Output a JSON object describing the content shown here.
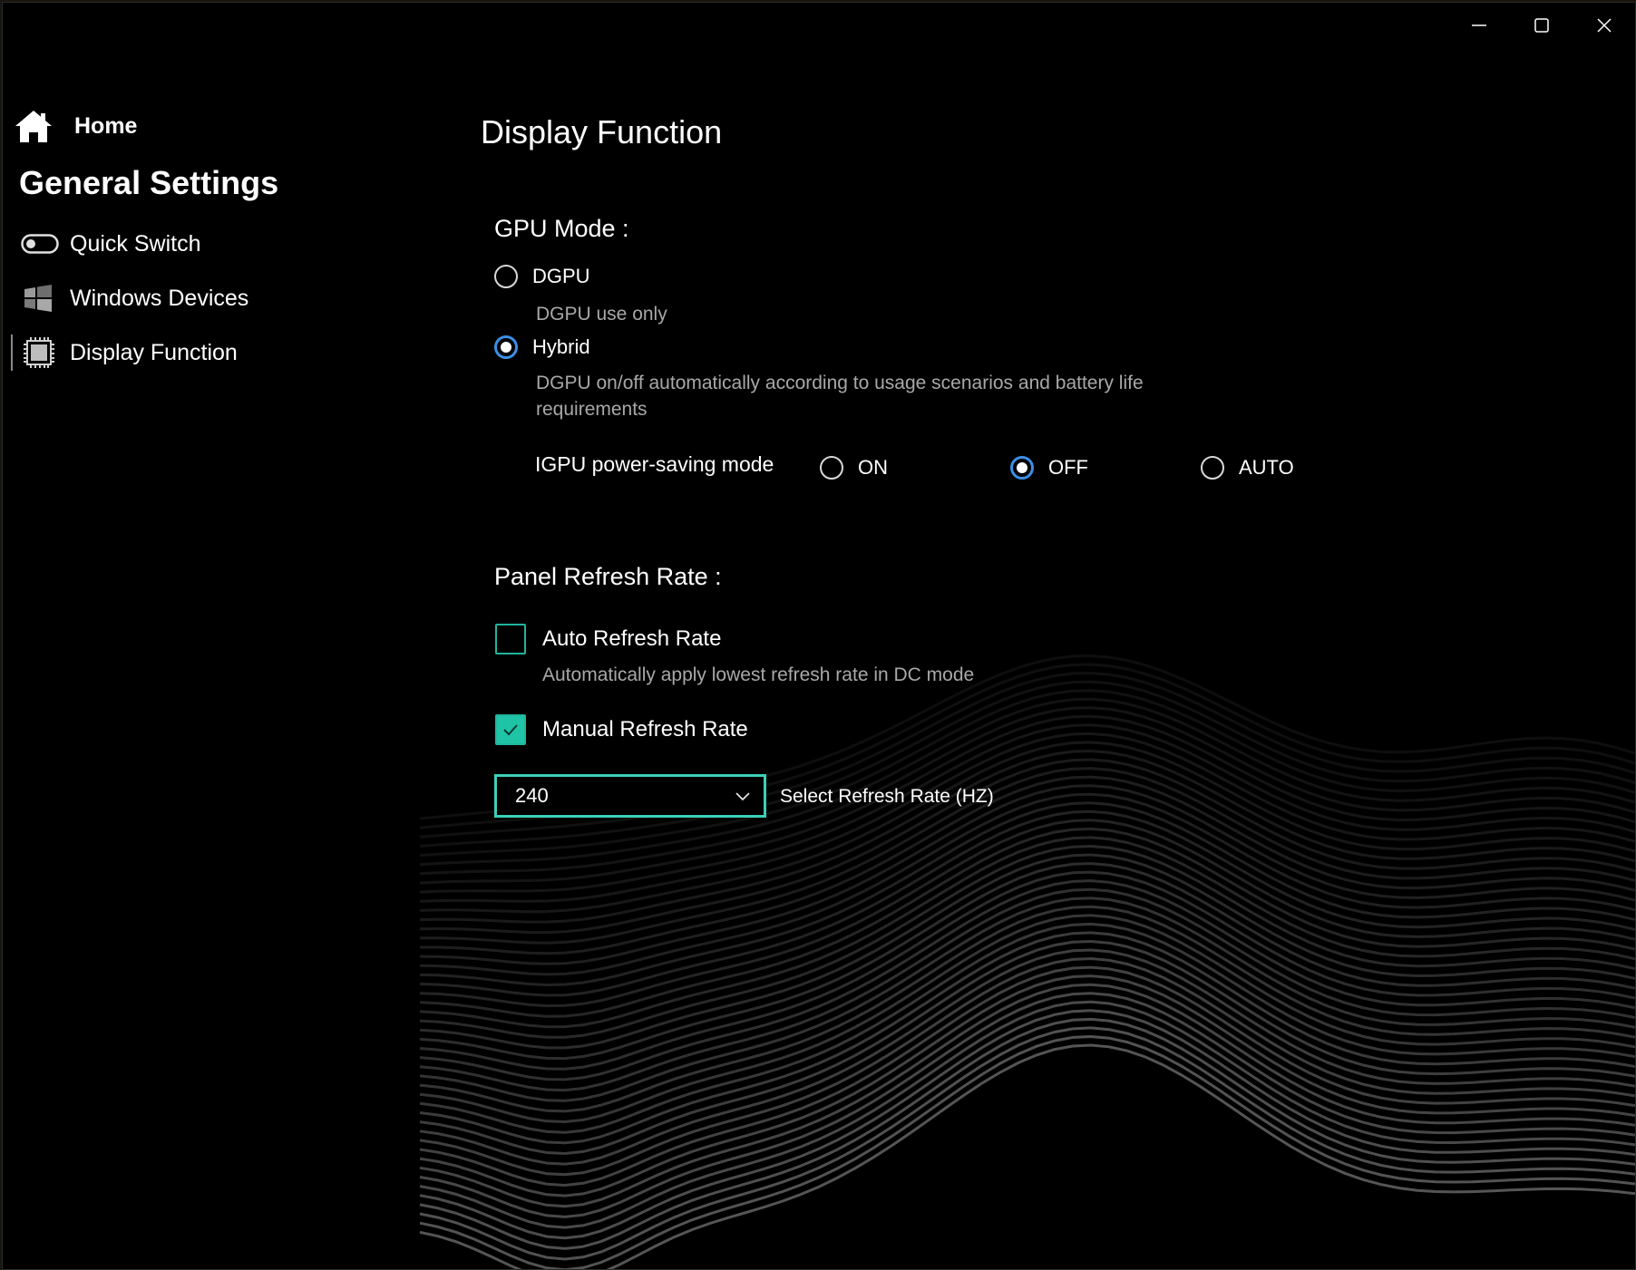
{
  "window": {
    "controls": [
      {
        "name": "minimize-button",
        "icon": "minimize-icon"
      },
      {
        "name": "maximize-button",
        "icon": "maximize-icon"
      },
      {
        "name": "close-button",
        "icon": "close-icon"
      }
    ]
  },
  "sidebar": {
    "home_label": "Home",
    "section_title": "General Settings",
    "items": [
      {
        "label": "Quick Switch",
        "icon": "toggle-switch-icon"
      },
      {
        "label": "Windows Devices",
        "icon": "windows-logo-icon"
      },
      {
        "label": "Display Function",
        "icon": "gpu-chip-icon",
        "selected": true
      }
    ]
  },
  "main": {
    "title": "Display Function",
    "gpu_mode": {
      "heading": "GPU Mode :",
      "options": [
        {
          "label": "DGPU",
          "description": "DGPU use only",
          "selected": false
        },
        {
          "label": "Hybrid",
          "description_line1": "DGPU on/off automatically according to usage scenarios and battery life",
          "description_line2": "requirements",
          "selected": true
        }
      ],
      "igpu_power_saving": {
        "label": "IGPU power-saving mode",
        "options": [
          {
            "label": "ON",
            "selected": false
          },
          {
            "label": "OFF",
            "selected": true
          },
          {
            "label": "AUTO",
            "selected": false
          }
        ]
      }
    },
    "panel_refresh_rate": {
      "heading": "Panel Refresh Rate :",
      "auto": {
        "label": "Auto Refresh Rate",
        "description": "Automatically apply lowest refresh rate in DC mode",
        "checked": false
      },
      "manual": {
        "label": "Manual Refresh Rate",
        "checked": true
      },
      "select": {
        "value": "240",
        "label": "Select Refresh Rate (HZ)"
      }
    }
  },
  "colors": {
    "accent": "#1fc4a6",
    "radio_selected": "#3b8fe6",
    "background": "#000000"
  }
}
